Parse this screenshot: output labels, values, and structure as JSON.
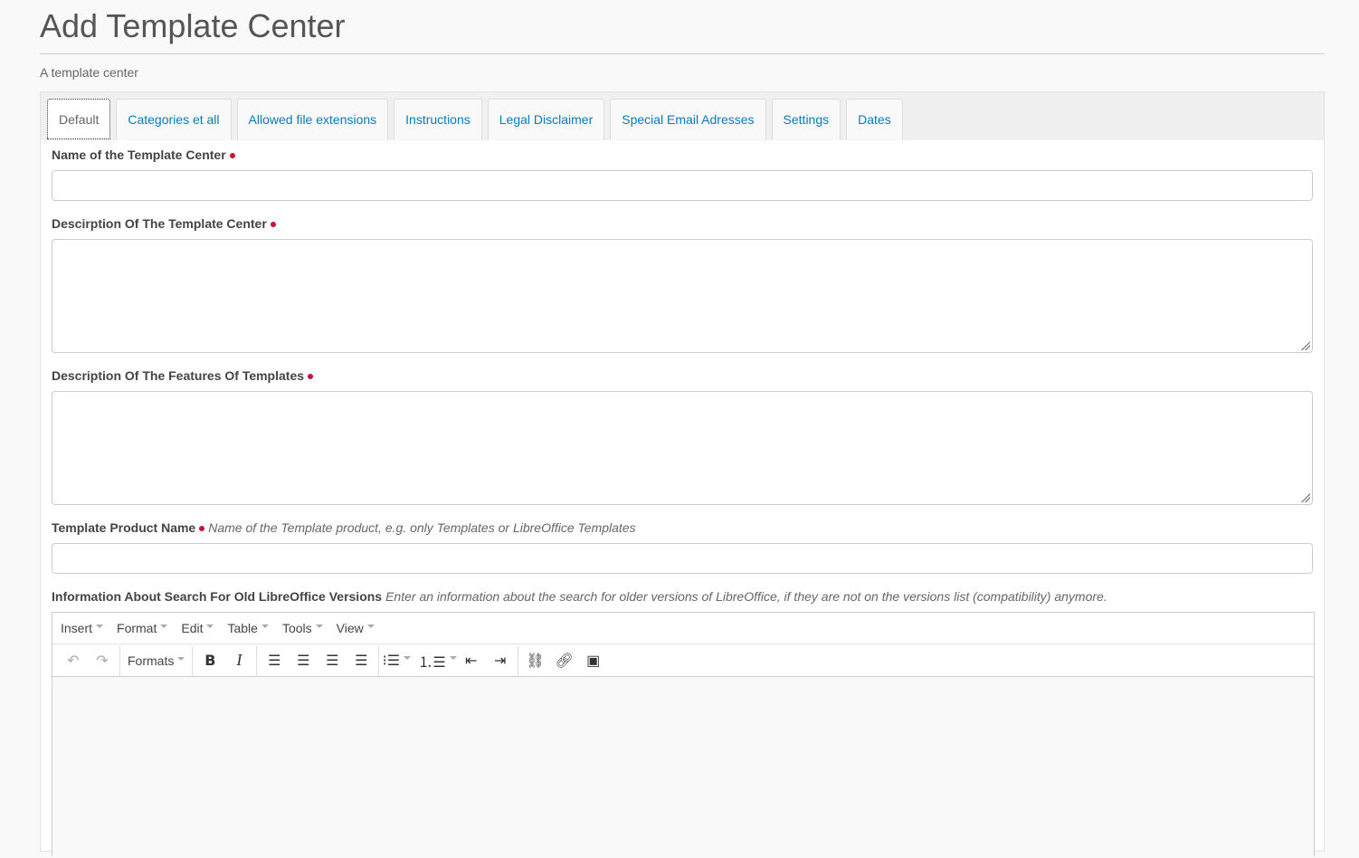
{
  "page": {
    "title": "Add Template Center",
    "subtitle": "A template center"
  },
  "tabs": [
    {
      "label": "Default"
    },
    {
      "label": "Categories et all"
    },
    {
      "label": "Allowed file extensions"
    },
    {
      "label": "Instructions"
    },
    {
      "label": "Legal Disclaimer"
    },
    {
      "label": "Special Email Adresses"
    },
    {
      "label": "Settings"
    },
    {
      "label": "Dates"
    }
  ],
  "form": {
    "name_label": "Name of the Template Center",
    "name_value": "",
    "description_label": "Descirption Of The Template Center",
    "description_value": "",
    "features_label": "Description Of The Features Of Templates",
    "features_value": "",
    "product_label": "Template Product Name",
    "product_hint": "Name of the Template product, e.g. only Templates or LibreOffice Templates",
    "product_value": "",
    "search_label": "Information About Search For Old LibreOffice Versions",
    "search_hint": "Enter an information about the search for older versions of LibreOffice, if they are not on the versions list (compatibility) anymore."
  },
  "editor": {
    "menus": [
      "Insert",
      "Format",
      "Edit",
      "Table",
      "Tools",
      "View"
    ],
    "formats_label": "Formats"
  },
  "colors": {
    "link": "#0a7ab8",
    "required": "#c9143a"
  }
}
